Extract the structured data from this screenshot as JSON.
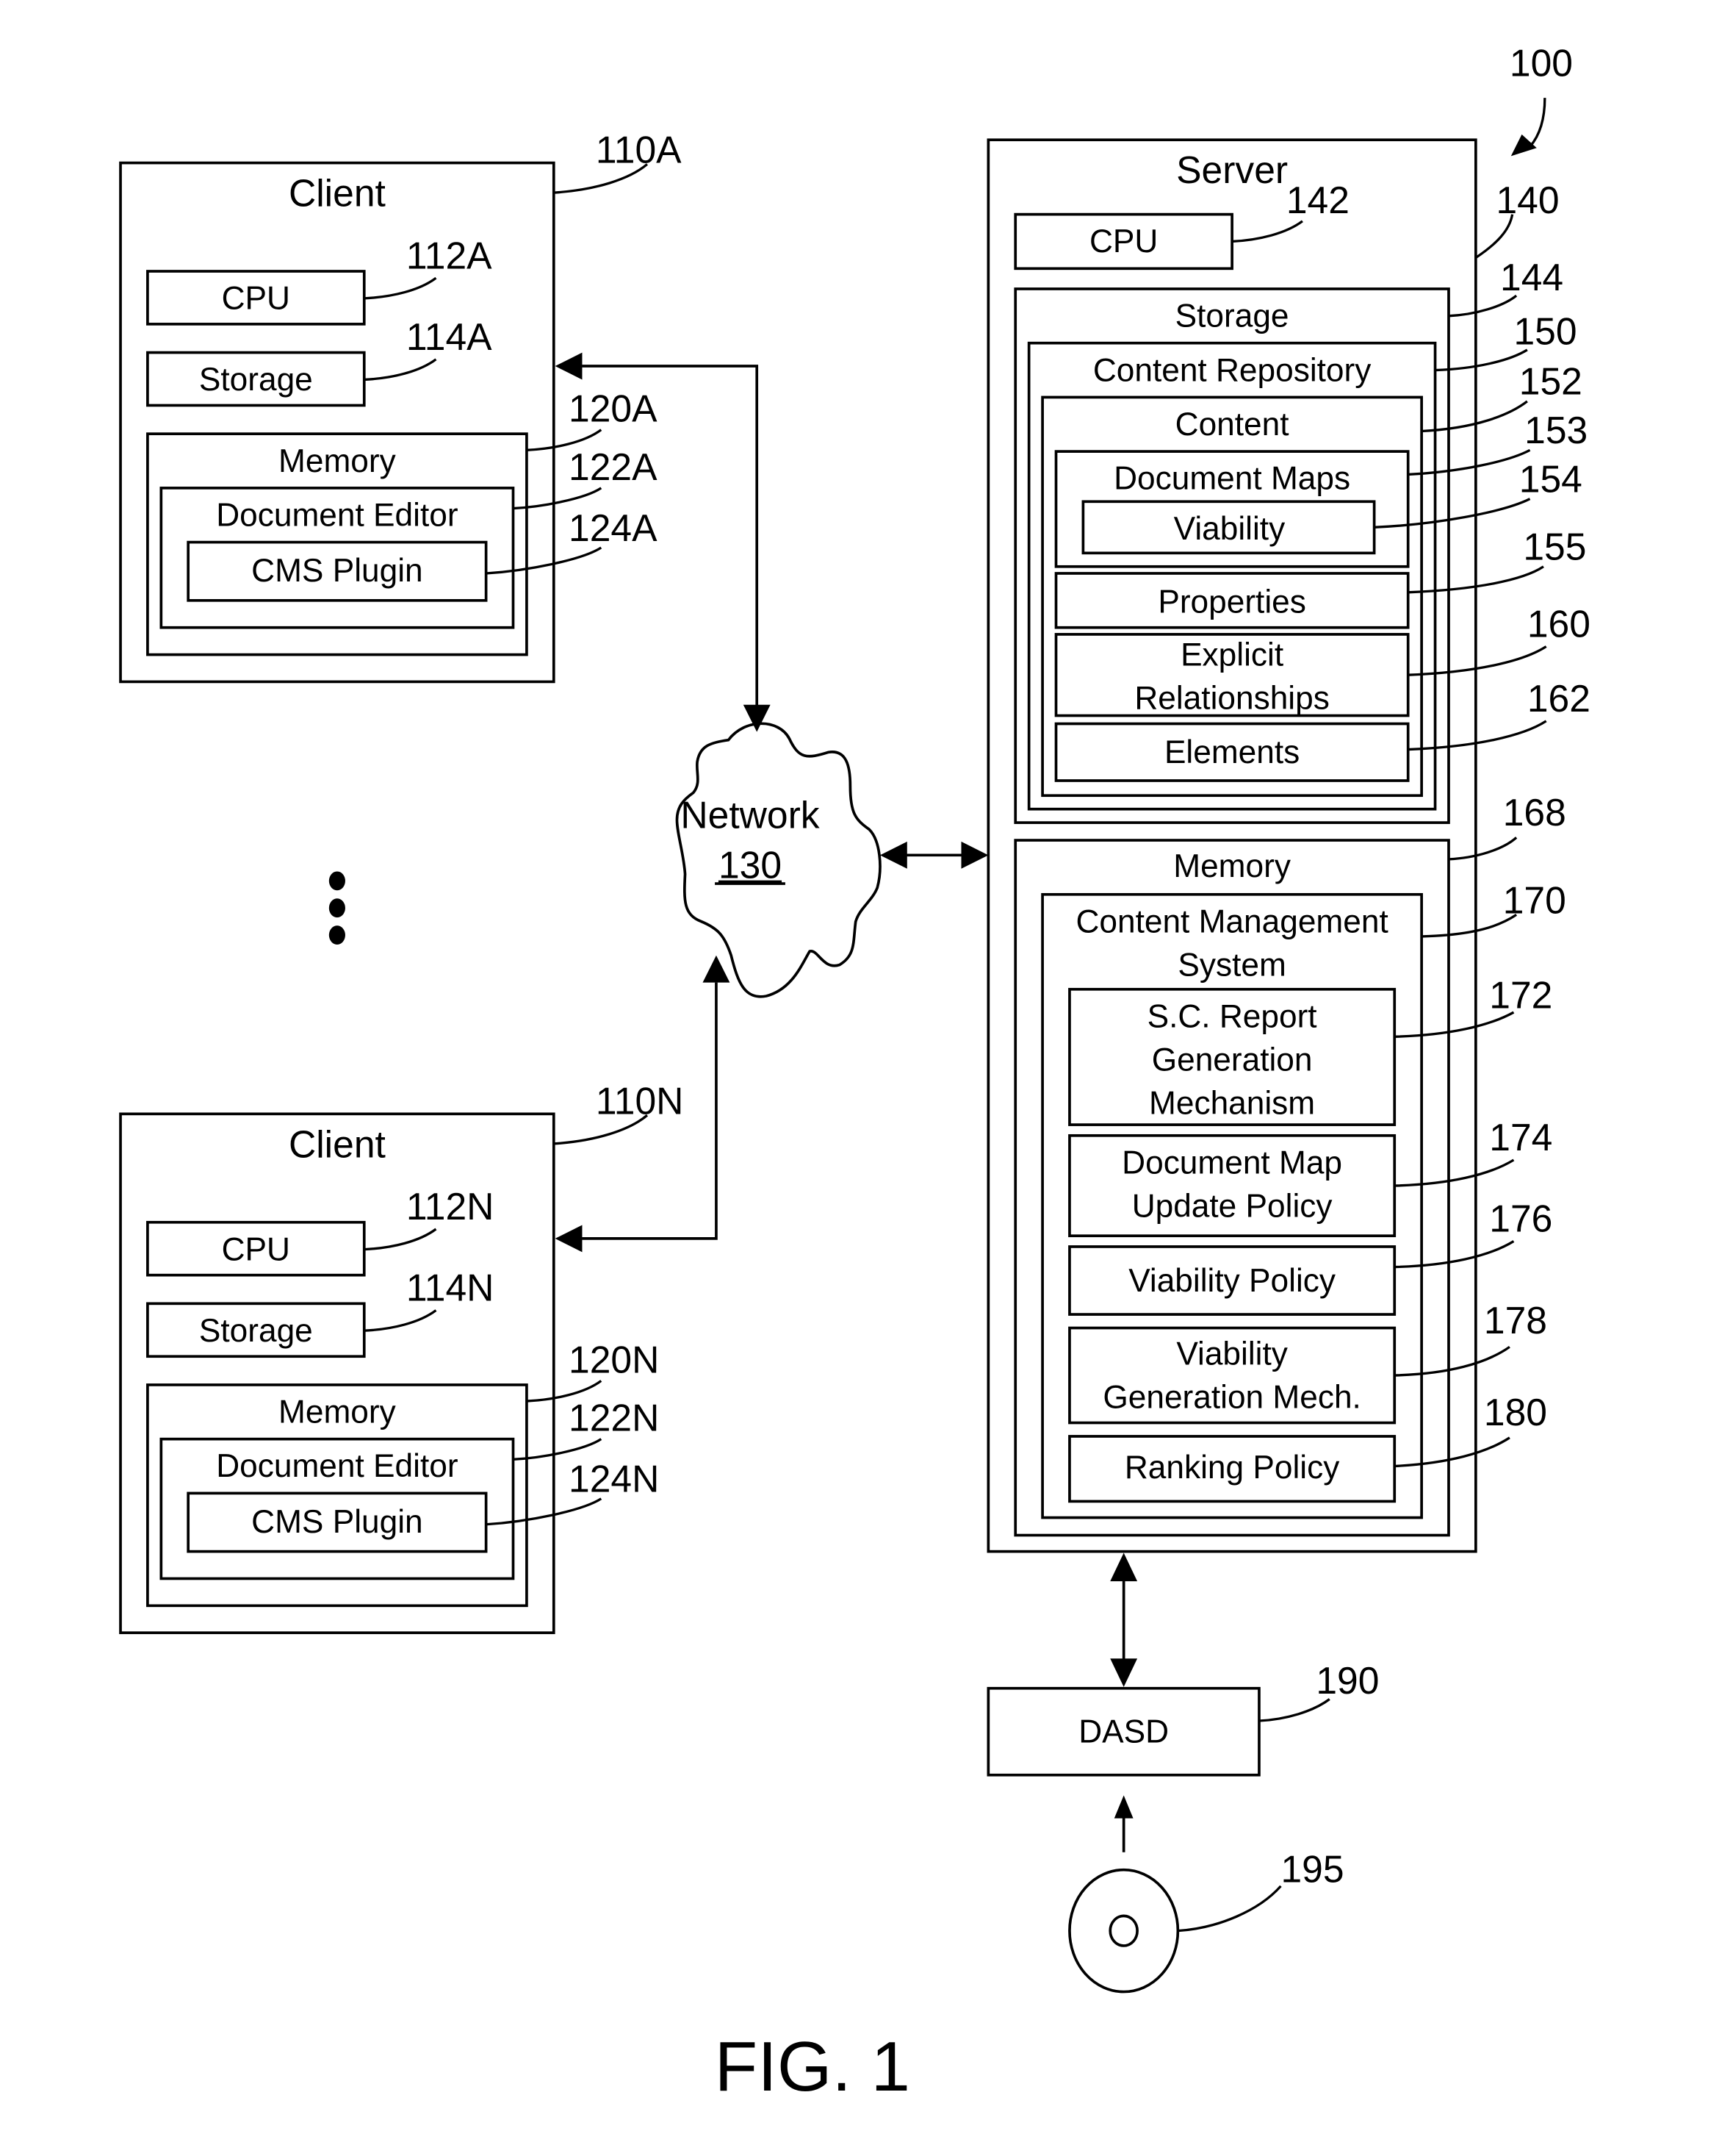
{
  "figure": {
    "caption": "FIG. 1",
    "system_ref": "100"
  },
  "client_a": {
    "title": "Client",
    "ref": "110A",
    "cpu": {
      "label": "CPU",
      "ref": "112A"
    },
    "storage": {
      "label": "Storage",
      "ref": "114A"
    },
    "memory": {
      "label": "Memory",
      "ref": "120A"
    },
    "editor": {
      "label": "Document Editor",
      "ref": "122A"
    },
    "plugin": {
      "label": "CMS Plugin",
      "ref": "124A"
    }
  },
  "client_n": {
    "title": "Client",
    "ref": "110N",
    "cpu": {
      "label": "CPU",
      "ref": "112N"
    },
    "storage": {
      "label": "Storage",
      "ref": "114N"
    },
    "memory": {
      "label": "Memory",
      "ref": "120N"
    },
    "editor": {
      "label": "Document Editor",
      "ref": "122N"
    },
    "plugin": {
      "label": "CMS Plugin",
      "ref": "124N"
    }
  },
  "network": {
    "label": "Network",
    "ref": "130"
  },
  "server": {
    "title": "Server",
    "ref": "140",
    "cpu": {
      "label": "CPU",
      "ref": "142"
    },
    "storage": {
      "label": "Storage",
      "ref": "144"
    },
    "repository": {
      "label": "Content Repository",
      "ref": "150"
    },
    "content": {
      "label": "Content",
      "ref": "152"
    },
    "document_maps": {
      "label": "Document Maps",
      "ref": "153"
    },
    "viability": {
      "label": "Viability",
      "ref": "154"
    },
    "properties": {
      "label": "Properties",
      "ref": "155"
    },
    "explicit_relationships": {
      "line1": "Explicit",
      "line2": "Relationships",
      "ref": "160"
    },
    "elements": {
      "label": "Elements",
      "ref": "162"
    },
    "memory": {
      "label": "Memory",
      "ref": "168"
    },
    "cms": {
      "line1": "Content Management",
      "line2": "System",
      "ref": "170"
    },
    "sc_report": {
      "line1": "S.C. Report",
      "line2": "Generation",
      "line3": "Mechanism",
      "ref": "172"
    },
    "doc_map_update": {
      "line1": "Document Map",
      "line2": "Update Policy",
      "ref": "174"
    },
    "viability_policy": {
      "label": "Viability Policy",
      "ref": "176"
    },
    "viability_gen": {
      "line1": "Viability",
      "line2": "Generation Mech.",
      "ref": "178"
    },
    "ranking_policy": {
      "label": "Ranking Policy",
      "ref": "180"
    }
  },
  "dasd": {
    "label": "DASD",
    "ref": "190"
  },
  "media": {
    "ref": "195"
  }
}
